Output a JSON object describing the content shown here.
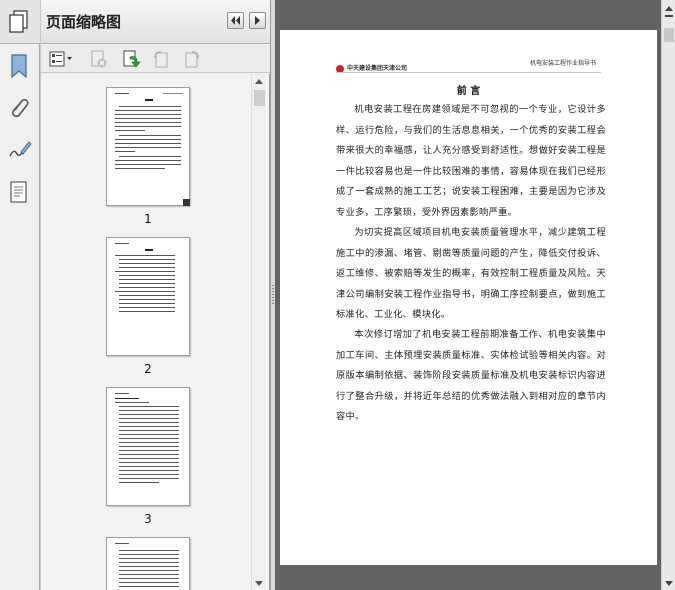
{
  "panel": {
    "title": "页面缩略图"
  },
  "thumbnails": [
    {
      "number": "1"
    },
    {
      "number": "2"
    },
    {
      "number": "3"
    }
  ],
  "document": {
    "logo_text": "中天建设集团天津公司",
    "running_header": "机电安装工程作业指导书",
    "title": "前 言",
    "paragraphs": [
      "机电安装工程在房建领域是不可忽视的一个专业，它设计多样、运行危险，与我们的生活息息相关，一个优秀的安装工程会带来很大的幸福感，让人充分感受到舒适性。想做好安装工程是一件比较容易也是一件比较困难的事情，容易体现在我们已经形成了一套成熟的施工工艺；说安装工程困难，主要是因为它涉及专业多，工序繁琐，受外界因素影响严重。",
      "为切实提高区域项目机电安装质量管理水平，减少建筑工程施工中的渗漏、堵管、剔凿等质量问题的产生，降低交付投诉、返工维修、被索赔等发生的概率，有效控制工程质量及风险。天津公司编制安装工程作业指导书，明确工序控制要点，做到施工标准化、工业化、模块化。",
      "本次修订增加了机电安装工程前期准备工作、机电安装集中加工车间、主体预埋安装质量标准、实体检试验等相关内容。对原版本编制依据、装饰阶段安装质量标准及机电安装标识内容进行了整合升级，并将近年总结的优秀做法融入到相对应的章节内容中。"
    ]
  },
  "colors": {
    "logo_red": "#c0292b",
    "viewer_bg": "#626262",
    "panel_bg": "#f3f3f3"
  },
  "icons": [
    "pages-icon",
    "bookmark-icon",
    "attachment-icon",
    "signature-icon",
    "layers-icon",
    "options-menu-icon",
    "delete-page-icon",
    "insert-page-icon",
    "rotate-left-icon",
    "rotate-right-icon",
    "collapse-panel-icon",
    "expand-panel-icon"
  ]
}
